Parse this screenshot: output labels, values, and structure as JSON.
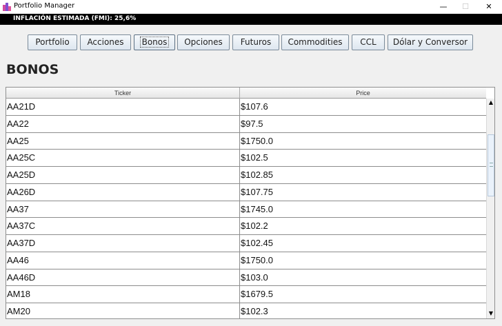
{
  "window": {
    "title": "Portfolio Manager",
    "min_glyph": "—",
    "max_glyph": "☐",
    "close_glyph": "✕"
  },
  "inflation_text": "INFLACIÓN ESTIMADA (FMI): 25,6%",
  "nav": {
    "portfolio": "Portfolio",
    "acciones": "Acciones",
    "bonos": "Bonos",
    "opciones": "Opciones",
    "futuros": "Futuros",
    "commodities": "Commodities",
    "ccl": "CCL",
    "dolar": "Dólar y Conversor"
  },
  "section_title": "BONOS",
  "table": {
    "columns": [
      "Ticker",
      "Price"
    ],
    "rows": [
      [
        "AA21D",
        "$107.6"
      ],
      [
        "AA22",
        "$97.5"
      ],
      [
        "AA25",
        "$1750.0"
      ],
      [
        "AA25C",
        "$102.5"
      ],
      [
        "AA25D",
        "$102.85"
      ],
      [
        "AA26D",
        "$107.75"
      ],
      [
        "AA37",
        "$1745.0"
      ],
      [
        "AA37C",
        "$102.2"
      ],
      [
        "AA37D",
        "$102.45"
      ],
      [
        "AA46",
        "$1750.0"
      ],
      [
        "AA46D",
        "$103.0"
      ],
      [
        "AM18",
        "$1679.5"
      ],
      [
        "AM20",
        "$102.3"
      ]
    ]
  },
  "scrollbar": {
    "up_glyph": "▲",
    "down_glyph": "▼"
  }
}
